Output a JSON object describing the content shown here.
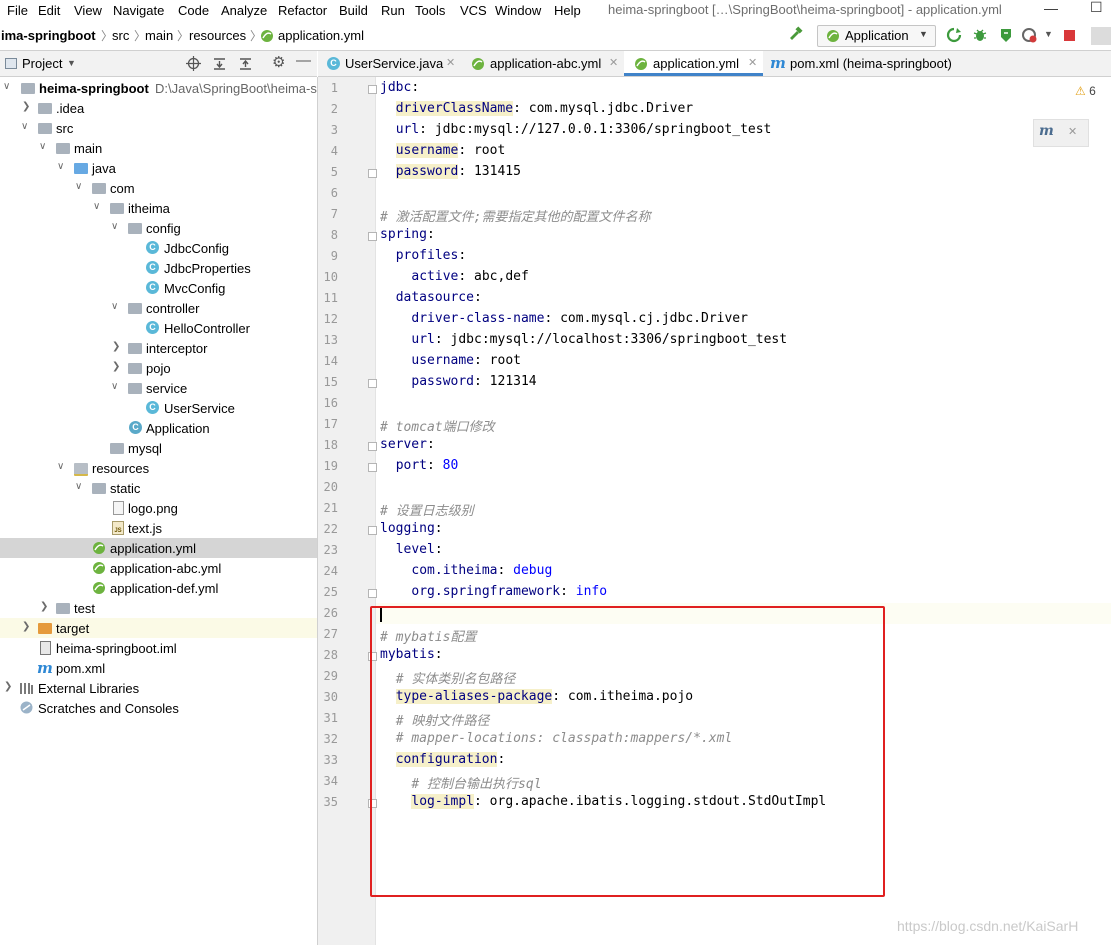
{
  "menu": [
    "File",
    "Edit",
    "View",
    "Navigate",
    "Code",
    "Analyze",
    "Refactor",
    "Build",
    "Run",
    "Tools",
    "VCS",
    "Window",
    "Help"
  ],
  "window_title": "heima-springboot […\\SpringBoot\\heima-springboot] - application.yml",
  "breadcrumb": [
    "ima-springboot",
    "src",
    "main",
    "resources",
    "application.yml"
  ],
  "run_config": "Application",
  "project_panel": {
    "title": "Project"
  },
  "tree": [
    {
      "label": "heima-springboot",
      "suffix": "D:\\Java\\SpringBoot\\heima-s"
    },
    {
      "label": ".idea"
    },
    {
      "label": "src"
    },
    {
      "label": "main"
    },
    {
      "label": "java"
    },
    {
      "label": "com"
    },
    {
      "label": "itheima"
    },
    {
      "label": "config"
    },
    {
      "label": "JdbcConfig"
    },
    {
      "label": "JdbcProperties"
    },
    {
      "label": "MvcConfig"
    },
    {
      "label": "controller"
    },
    {
      "label": "HelloController"
    },
    {
      "label": "interceptor"
    },
    {
      "label": "pojo"
    },
    {
      "label": "service"
    },
    {
      "label": "UserService"
    },
    {
      "label": "Application"
    },
    {
      "label": "mysql"
    },
    {
      "label": "resources"
    },
    {
      "label": "static"
    },
    {
      "label": "logo.png"
    },
    {
      "label": "text.js"
    },
    {
      "label": "application.yml"
    },
    {
      "label": "application-abc.yml"
    },
    {
      "label": "application-def.yml"
    },
    {
      "label": "test"
    },
    {
      "label": "target"
    },
    {
      "label": "heima-springboot.iml"
    },
    {
      "label": "pom.xml"
    },
    {
      "label": "External Libraries"
    },
    {
      "label": "Scratches and Consoles"
    }
  ],
  "tabs": [
    "UserService.java",
    "application-abc.yml",
    "application.yml",
    "pom.xml (heima-springboot)"
  ],
  "warnings_count": "6",
  "code": [
    {
      "n": "1",
      "k": "jdbc",
      "v": ""
    },
    {
      "n": "2",
      "k": "driverClassName",
      "v": "com.mysql.jdbc.Driver"
    },
    {
      "n": "3",
      "k": "url",
      "v": "jdbc:mysql://127.0.0.1:3306/springboot_test"
    },
    {
      "n": "4",
      "k": "username",
      "v": "root"
    },
    {
      "n": "5",
      "k": "password",
      "v": "131415"
    },
    {
      "n": "6"
    },
    {
      "n": "7",
      "c": "# 激活配置文件;需要指定其他的配置文件名称"
    },
    {
      "n": "8",
      "k": "spring",
      "v": ""
    },
    {
      "n": "9",
      "k": "profiles",
      "v": ""
    },
    {
      "n": "10",
      "k": "active",
      "v": "abc,def"
    },
    {
      "n": "11",
      "k": "datasource",
      "v": ""
    },
    {
      "n": "12",
      "k": "driver-class-name",
      "v": "com.mysql.cj.jdbc.Driver"
    },
    {
      "n": "13",
      "k": "url",
      "v": "jdbc:mysql://localhost:3306/springboot_test"
    },
    {
      "n": "14",
      "k": "username",
      "v": "root"
    },
    {
      "n": "15",
      "k": "password",
      "v": "121314"
    },
    {
      "n": "16"
    },
    {
      "n": "17",
      "c": "# tomcat端口修改"
    },
    {
      "n": "18",
      "k": "server",
      "v": ""
    },
    {
      "n": "19",
      "k": "port",
      "v": "80"
    },
    {
      "n": "20"
    },
    {
      "n": "21",
      "c": "# 设置日志级别"
    },
    {
      "n": "22",
      "k": "logging",
      "v": ""
    },
    {
      "n": "23",
      "k": "level",
      "v": ""
    },
    {
      "n": "24",
      "k": "com.itheima",
      "v": "debug"
    },
    {
      "n": "25",
      "k": "org.springframework",
      "v": "info"
    },
    {
      "n": "26"
    },
    {
      "n": "27",
      "c": "# mybatis配置"
    },
    {
      "n": "28",
      "k": "mybatis",
      "v": ""
    },
    {
      "n": "29",
      "c": "# 实体类别名包路径"
    },
    {
      "n": "30",
      "k": "type-aliases-package",
      "v": "com.itheima.pojo"
    },
    {
      "n": "31",
      "c": "# 映射文件路径"
    },
    {
      "n": "32",
      "c": "# mapper-locations: classpath:mappers/*.xml"
    },
    {
      "n": "33",
      "k": "configuration",
      "v": ""
    },
    {
      "n": "34",
      "c": "# 控制台输出执行sql"
    },
    {
      "n": "35",
      "k": "log-impl",
      "v": "org.apache.ibatis.logging.stdout.StdOutImpl"
    }
  ],
  "watermark": "https://blog.csdn.net/KaiSarH"
}
